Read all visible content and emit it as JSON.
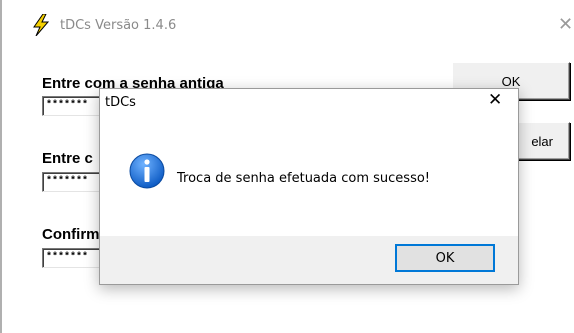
{
  "window": {
    "title": "tDCs Versão 1.4.6",
    "close_glyph": "✕",
    "app_icon": "lightning-bolt-icon"
  },
  "form": {
    "old_password_label": "Entre com a senha antiga",
    "new_password_label": "Entre c",
    "confirm_label": "Confirm",
    "old_password_value": "*******",
    "new_password_value": "*******",
    "confirm_value": "*******",
    "ok_label": "OK",
    "cancel_label": "elar"
  },
  "dialog": {
    "title": "tDCs",
    "close_glyph": "✕",
    "icon": "info-icon",
    "message": "Troca de senha efetuada com sucesso!",
    "ok_label": "OK"
  },
  "colors": {
    "icon_blue": "#1c6fd1",
    "bolt_yellow": "#f5d000",
    "focus_border": "#0078d7",
    "dialog_footer": "#f0f0f0"
  }
}
